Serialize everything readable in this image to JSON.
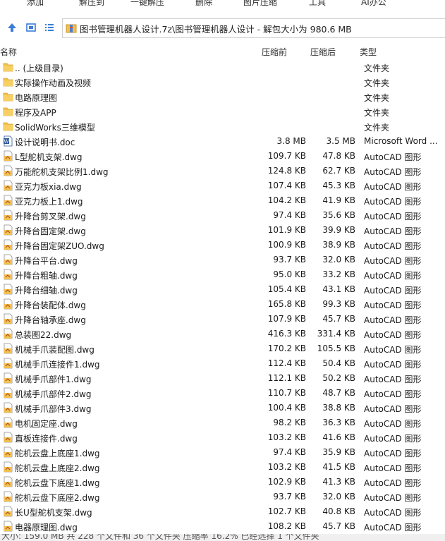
{
  "toolbar": {
    "buttons": [
      "添加",
      "解压到",
      "一键解压",
      "删除",
      "图片压缩",
      "工具",
      "AI办公"
    ]
  },
  "address": {
    "path": "图书管理机器人设计.7z\\图书管理机器人设计 - 解包大小为 980.6 MB",
    "icons": [
      "up-arrow-icon",
      "view-icon",
      "list-view-icon",
      "archive-icon"
    ]
  },
  "columns": {
    "name": "名称",
    "size": "压缩前",
    "packed": "压缩后",
    "type": "类型"
  },
  "rows": [
    {
      "name": ".. (上级目录)",
      "size": "",
      "packed": "",
      "type": "文件夹",
      "icon": "folder"
    },
    {
      "name": "实际操作动画及视频",
      "size": "",
      "packed": "",
      "type": "文件夹",
      "icon": "folder"
    },
    {
      "name": "电路原理图",
      "size": "",
      "packed": "",
      "type": "文件夹",
      "icon": "folder"
    },
    {
      "name": "程序及APP",
      "size": "",
      "packed": "",
      "type": "文件夹",
      "icon": "folder"
    },
    {
      "name": "SolidWorks三维模型",
      "size": "",
      "packed": "",
      "type": "文件夹",
      "icon": "folder"
    },
    {
      "name": "设计说明书.doc",
      "size": "3.8 MB",
      "packed": "3.5 MB",
      "type": "Microsoft Word ...",
      "icon": "word"
    },
    {
      "name": "L型舵机支架.dwg",
      "size": "109.7 KB",
      "packed": "47.8 KB",
      "type": "AutoCAD 图形",
      "icon": "dwg"
    },
    {
      "name": "万能舵机支架比例1.dwg",
      "size": "124.8 KB",
      "packed": "62.7 KB",
      "type": "AutoCAD 图形",
      "icon": "dwg"
    },
    {
      "name": "亚克力板xia.dwg",
      "size": "107.4 KB",
      "packed": "45.3 KB",
      "type": "AutoCAD 图形",
      "icon": "dwg"
    },
    {
      "name": "亚克力板上1.dwg",
      "size": "104.2 KB",
      "packed": "41.9 KB",
      "type": "AutoCAD 图形",
      "icon": "dwg"
    },
    {
      "name": "升降台剪叉架.dwg",
      "size": "97.4 KB",
      "packed": "35.6 KB",
      "type": "AutoCAD 图形",
      "icon": "dwg"
    },
    {
      "name": "升降台固定架.dwg",
      "size": "101.9 KB",
      "packed": "39.9 KB",
      "type": "AutoCAD 图形",
      "icon": "dwg"
    },
    {
      "name": "升降台固定架ZUO.dwg",
      "size": "100.9 KB",
      "packed": "38.9 KB",
      "type": "AutoCAD 图形",
      "icon": "dwg"
    },
    {
      "name": "升降台平台.dwg",
      "size": "93.7 KB",
      "packed": "32.0 KB",
      "type": "AutoCAD 图形",
      "icon": "dwg"
    },
    {
      "name": "升降台粗轴.dwg",
      "size": "95.0 KB",
      "packed": "33.2 KB",
      "type": "AutoCAD 图形",
      "icon": "dwg"
    },
    {
      "name": "升降台细轴.dwg",
      "size": "105.4 KB",
      "packed": "43.1 KB",
      "type": "AutoCAD 图形",
      "icon": "dwg"
    },
    {
      "name": "升降台装配体.dwg",
      "size": "165.8 KB",
      "packed": "99.3 KB",
      "type": "AutoCAD 图形",
      "icon": "dwg"
    },
    {
      "name": "升降台轴承座.dwg",
      "size": "107.9 KB",
      "packed": "45.7 KB",
      "type": "AutoCAD 图形",
      "icon": "dwg"
    },
    {
      "name": "总装图22.dwg",
      "size": "416.3 KB",
      "packed": "331.4 KB",
      "type": "AutoCAD 图形",
      "icon": "dwg"
    },
    {
      "name": "机械手爪装配图.dwg",
      "size": "170.2 KB",
      "packed": "105.5 KB",
      "type": "AutoCAD 图形",
      "icon": "dwg"
    },
    {
      "name": "机械手爪连接件1.dwg",
      "size": "112.4 KB",
      "packed": "50.4 KB",
      "type": "AutoCAD 图形",
      "icon": "dwg"
    },
    {
      "name": "机械手爪部件1.dwg",
      "size": "112.1 KB",
      "packed": "50.2 KB",
      "type": "AutoCAD 图形",
      "icon": "dwg"
    },
    {
      "name": "机械手爪部件2.dwg",
      "size": "110.7 KB",
      "packed": "48.7 KB",
      "type": "AutoCAD 图形",
      "icon": "dwg"
    },
    {
      "name": "机械手爪部件3.dwg",
      "size": "100.4 KB",
      "packed": "38.8 KB",
      "type": "AutoCAD 图形",
      "icon": "dwg"
    },
    {
      "name": "电机固定座.dwg",
      "size": "98.2 KB",
      "packed": "36.3 KB",
      "type": "AutoCAD 图形",
      "icon": "dwg"
    },
    {
      "name": "直板连接件.dwg",
      "size": "103.2 KB",
      "packed": "41.6 KB",
      "type": "AutoCAD 图形",
      "icon": "dwg"
    },
    {
      "name": "舵机云盘上底座1.dwg",
      "size": "97.4 KB",
      "packed": "35.9 KB",
      "type": "AutoCAD 图形",
      "icon": "dwg"
    },
    {
      "name": "舵机云盘上底座2.dwg",
      "size": "103.2 KB",
      "packed": "41.5 KB",
      "type": "AutoCAD 图形",
      "icon": "dwg"
    },
    {
      "name": "舵机云盘下底座1.dwg",
      "size": "102.9 KB",
      "packed": "41.3 KB",
      "type": "AutoCAD 图形",
      "icon": "dwg"
    },
    {
      "name": "舵机云盘下底座2.dwg",
      "size": "93.7 KB",
      "packed": "32.0 KB",
      "type": "AutoCAD 图形",
      "icon": "dwg"
    },
    {
      "name": "长U型舵机支架.dwg",
      "size": "102.7 KB",
      "packed": "40.8 KB",
      "type": "AutoCAD 图形",
      "icon": "dwg"
    },
    {
      "name": "电器原理图.dwg",
      "size": "108.2 KB",
      "packed": "45.7 KB",
      "type": "AutoCAD 图形",
      "icon": "dwg"
    }
  ],
  "status": {
    "text": "大小: 159.0 MB 共 228 个文件和 36 个文件夹 压缩率 16.2% 已经选择 1 个文件夹"
  },
  "colors": {
    "folder": "#f2c14e",
    "dwg_accent": "#f2c14e",
    "dwg_paper": "#ffffff",
    "word_blue": "#2b579a",
    "nav_blue": "#3b7dd8"
  }
}
